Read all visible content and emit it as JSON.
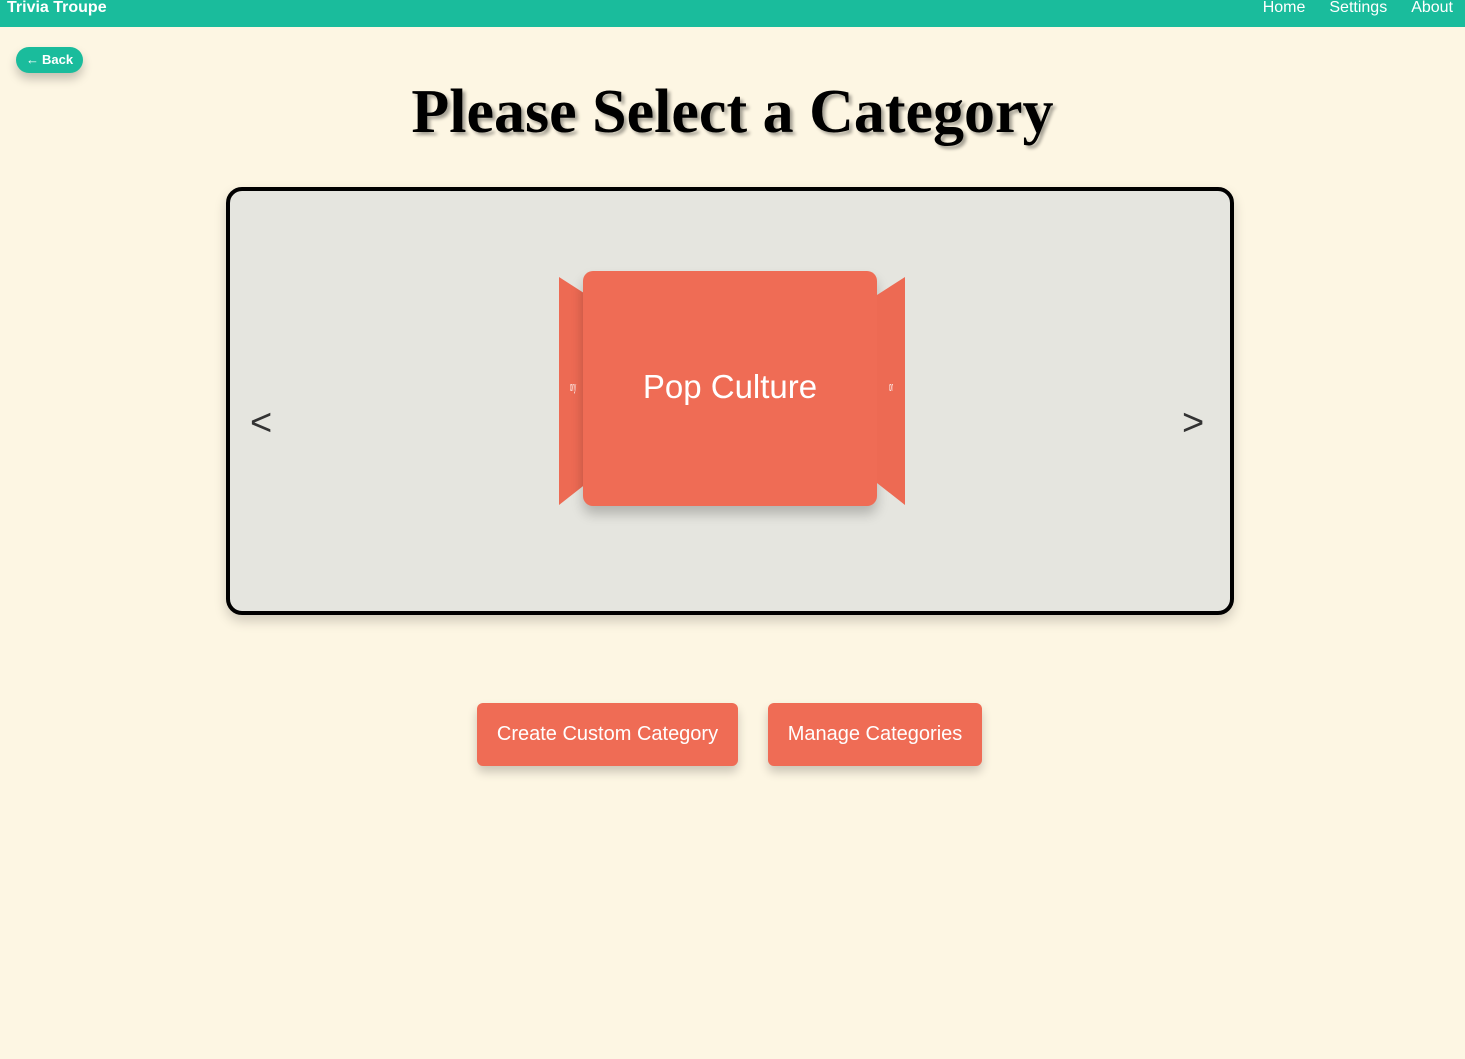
{
  "navbar": {
    "brand": "Trivia Troupe",
    "links": [
      {
        "label": "Home"
      },
      {
        "label": "Settings"
      },
      {
        "label": "About"
      }
    ]
  },
  "back_button": {
    "icon": "left-arrow-icon",
    "arrow_glyph": "←",
    "label": "Back"
  },
  "page": {
    "title": "Please Select a Category"
  },
  "carousel": {
    "prev_glyph": "<",
    "next_glyph": ">",
    "current_category": "Pop Culture",
    "side_left_text": "ory",
    "side_right_text": "or"
  },
  "actions": {
    "create_label": "Create Custom Category",
    "manage_label": "Manage Categories"
  },
  "colors": {
    "navbar": "#1abc9c",
    "background": "#fdf6e3",
    "card": "#ef6c55",
    "carousel_bg": "#e5e5df"
  }
}
